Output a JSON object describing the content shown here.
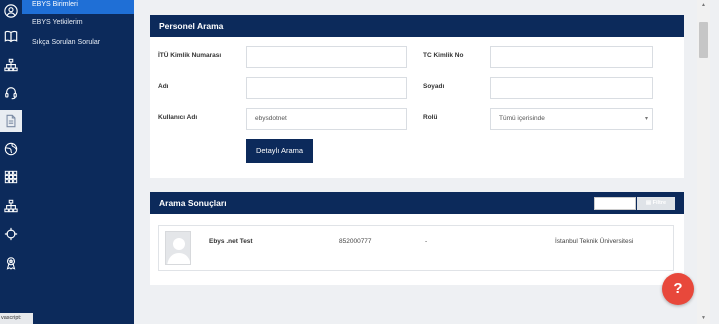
{
  "sidebar": {
    "items": [
      {
        "label": "EBYS Birimleri"
      },
      {
        "label": "EBYS Yetkilerim"
      },
      {
        "label": "Sıkça Sorulan Sorular"
      }
    ]
  },
  "status_hint": "vascript:",
  "search_panel": {
    "title": "Personel Arama",
    "fields": {
      "itu_id_label": "İTÜ Kimlik Numarası",
      "tc_label": "TC Kimlik No",
      "name_label": "Adı",
      "surname_label": "Soyadı",
      "username_label": "Kullanıcı Adı",
      "username_value": "ebysdotnet",
      "role_label": "Rolü",
      "role_value": "Tümü içerisinde"
    },
    "detail_button": "Detaylı Arama"
  },
  "results_panel": {
    "title": "Arama Sonuçları",
    "filter_label": "Filtre",
    "rows": [
      {
        "name": "Ebys .net Test",
        "number": "852000777",
        "dash": "-",
        "institution": "İstanbul Teknik Üniversitesi"
      }
    ]
  },
  "help": {
    "label": "?"
  },
  "colors": {
    "navy": "#0c2a5b",
    "active_blue": "#1f6fd6",
    "help_red": "#e8483b"
  }
}
